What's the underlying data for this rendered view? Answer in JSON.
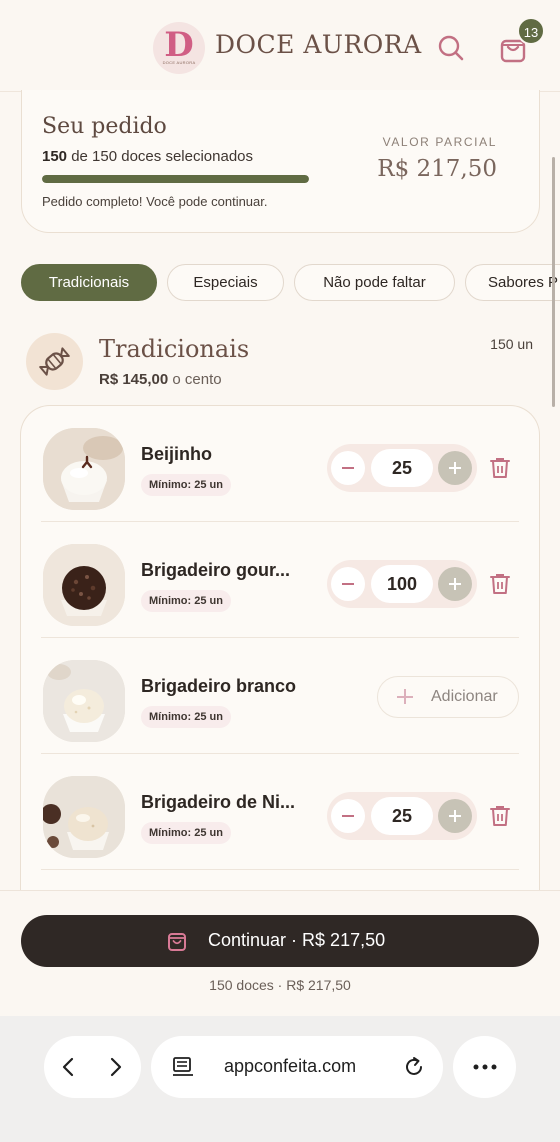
{
  "header": {
    "logo_letter": "D",
    "logo_small_text": "DOCE AURORA",
    "brand": "DOCE AURORA",
    "cart_count": "13",
    "icons": {
      "search": "search-icon",
      "cart": "shopping-bag-icon"
    }
  },
  "order": {
    "title": "Seu pedido",
    "count_selected": "150",
    "count_suffix": "de 150 doces selecionados",
    "progress_fraction": 1.0,
    "message": "Pedido completo! Você pode continuar.",
    "partial_label": "VALOR PARCIAL",
    "partial_value": "R$ 217,50"
  },
  "tabs": [
    {
      "label": "Tradicionais",
      "active": true
    },
    {
      "label": "Especiais",
      "active": false
    },
    {
      "label": "Não pode faltar",
      "active": false
    },
    {
      "label": "Sabores P",
      "active": false
    }
  ],
  "section": {
    "title": "Tradicionais",
    "price_value": "R$ 145,00",
    "price_suffix": "o cento",
    "count": "150 un",
    "icon": "candy-icon"
  },
  "products": [
    {
      "name": "Beijinho",
      "minimum": "Mínimo: 25 un",
      "quantity": "25",
      "in_cart": true
    },
    {
      "name": "Brigadeiro gour...",
      "minimum": "Mínimo: 25 un",
      "quantity": "100",
      "in_cart": true
    },
    {
      "name": "Brigadeiro branco",
      "minimum": "Mínimo: 25 un",
      "add_label": "Adicionar",
      "in_cart": false
    },
    {
      "name": "Brigadeiro de Ni...",
      "minimum": "Mínimo: 25 un",
      "quantity": "25",
      "in_cart": true
    }
  ],
  "footer": {
    "cta_label": "Continuar · R$ 217,50",
    "summary": "150 doces · R$ 217,50"
  },
  "browser": {
    "url": "appconfeita.com",
    "icons": {
      "back": "chevron-left-icon",
      "forward": "chevron-right-icon",
      "reader": "reader-icon",
      "reload": "reload-icon",
      "more": "more-icon"
    }
  },
  "colors": {
    "accent_green": "#606b43",
    "brand_brown": "#6b5147",
    "cta_dark": "#2f2825",
    "rose": "#c27083",
    "background": "#fbf7f2"
  }
}
